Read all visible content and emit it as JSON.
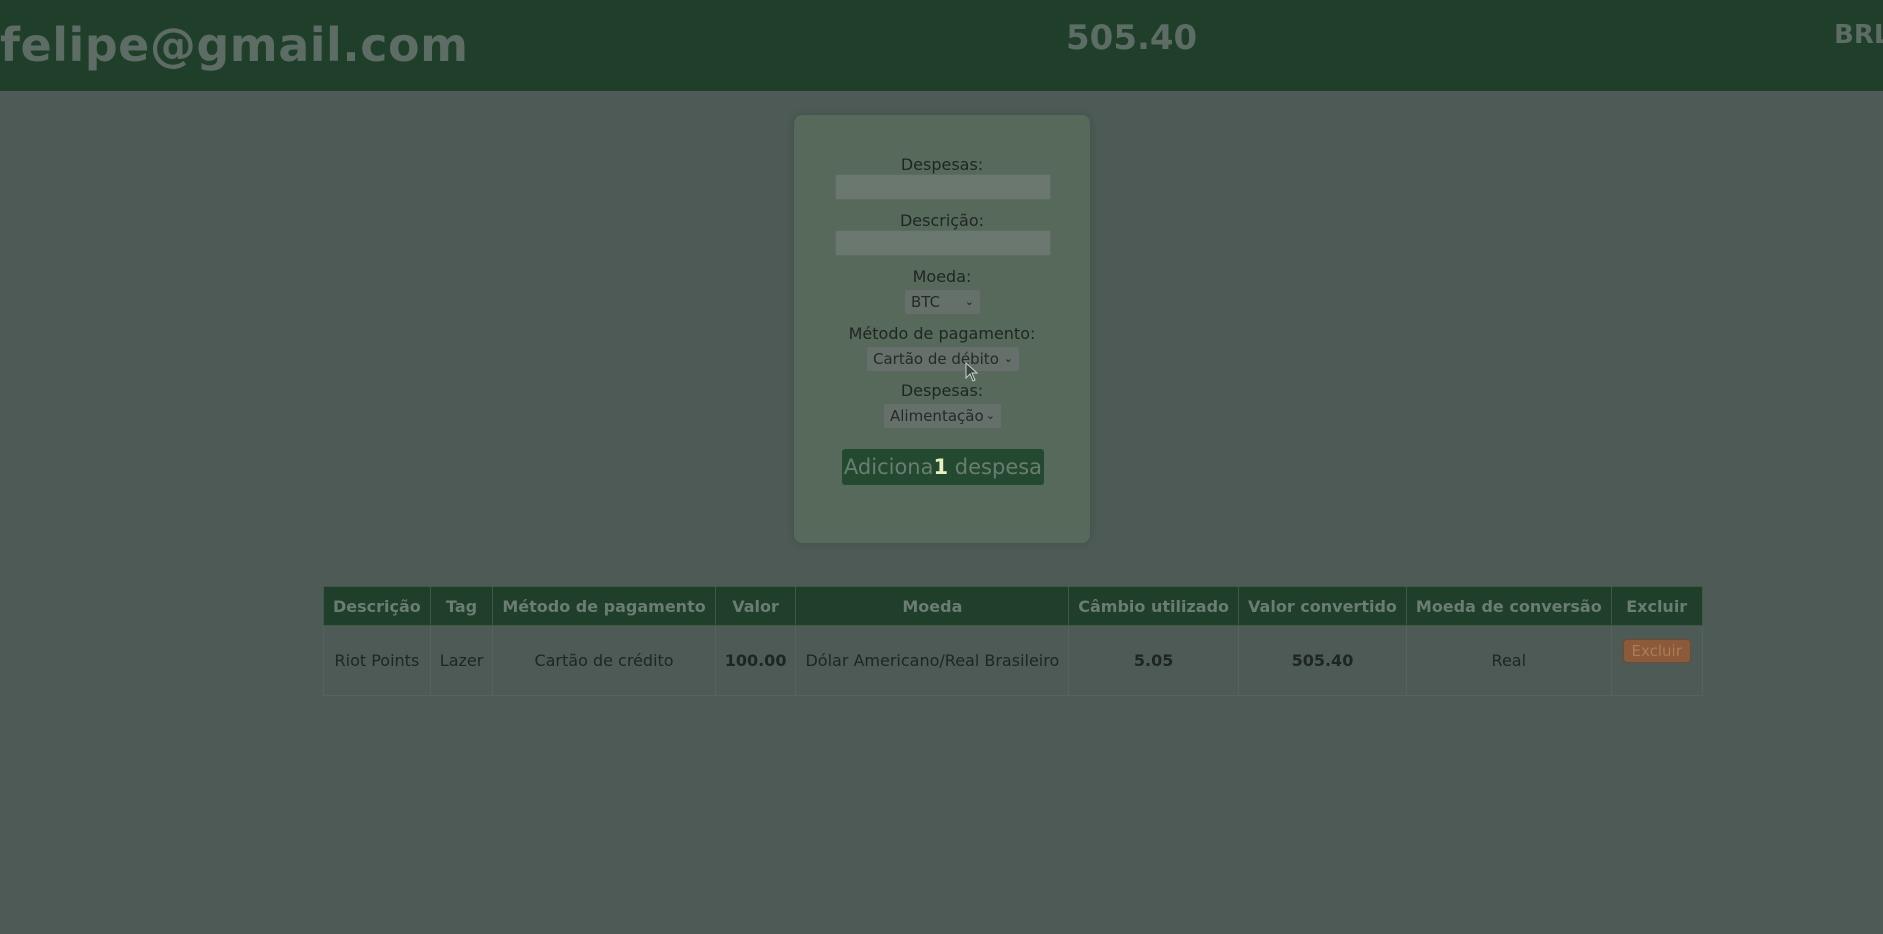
{
  "header": {
    "email": "felipe@gmail.com",
    "total": "505.40",
    "currency": "BRL"
  },
  "form": {
    "expense_label": "Despesas:",
    "expense_value": "",
    "description_label": "Descrição:",
    "description_value": "",
    "currency_label": "Moeda:",
    "currency_selected": "BTC",
    "method_label": "Método de pagamento:",
    "method_selected": "Cartão de débito",
    "tag_label": "Despesas:",
    "tag_selected": "Alimentação",
    "add_button_prefix": "Adiciona",
    "add_button_caret": "1",
    "add_button_suffix": " despesa"
  },
  "table": {
    "headers": [
      "Descrição",
      "Tag",
      "Método de pagamento",
      "Valor",
      "Moeda",
      "Câmbio utilizado",
      "Valor convertido",
      "Moeda de conversão",
      "Excluir"
    ],
    "rows": [
      {
        "description": "Riot Points",
        "tag": "Lazer",
        "method": "Cartão de crédito",
        "value": "100.00",
        "currency": "Dólar Americano/Real Brasileiro",
        "exchange_rate": "5.05",
        "converted_value": "505.40",
        "conversion_currency": "Real",
        "delete_label": "Excluir"
      }
    ]
  },
  "colors": {
    "header_bg": "#1f3f2a",
    "page_bg": "#4d5a55",
    "card_bg": "#56695b",
    "button_bg": "#234a30",
    "delete_bg": "#8a5a3a"
  }
}
